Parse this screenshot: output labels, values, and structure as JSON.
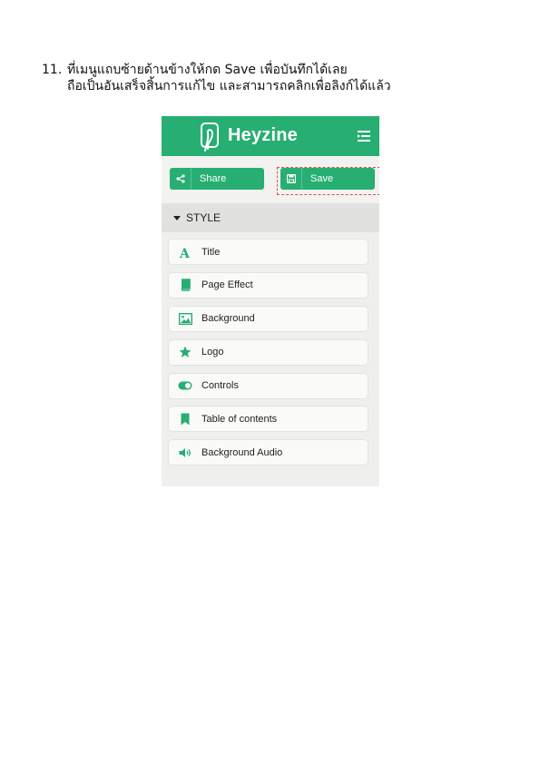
{
  "instruction": {
    "number": "11.",
    "line1": "ที่เมนูแถบซ้ายด้านข้างให้กด Save เพื่อบันทึกได้เลย",
    "line2": "ถือเป็นอันเสร็จสิ้นการแก้ไข และสามารถคลิกเพื่อลิงก์ได้แล้ว"
  },
  "app": {
    "brand": "Heyzine",
    "share_label": "Share",
    "save_label": "Save",
    "section_label": "STYLE",
    "menu_items": [
      {
        "label": "Title",
        "icon": "title-letter-icon"
      },
      {
        "label": "Page Effect",
        "icon": "book-icon"
      },
      {
        "label": "Background",
        "icon": "image-icon"
      },
      {
        "label": "Logo",
        "icon": "star-icon"
      },
      {
        "label": "Controls",
        "icon": "toggle-icon"
      },
      {
        "label": "Table of contents",
        "icon": "bookmark-icon"
      },
      {
        "label": "Background Audio",
        "icon": "speaker-icon"
      }
    ]
  },
  "colors": {
    "brand_green": "#27ae72",
    "highlight_red": "#d9534f"
  }
}
